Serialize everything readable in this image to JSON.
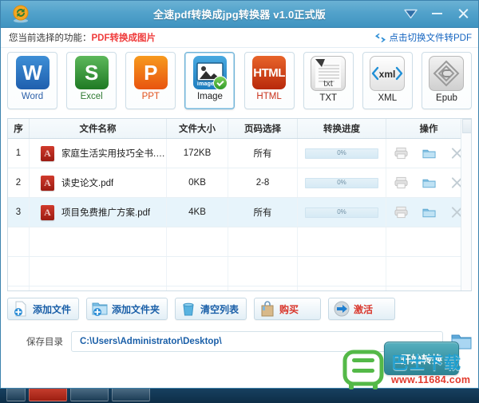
{
  "window": {
    "title": "全速pdf转换成jpg转换器 v1.0正式版",
    "logo_icon": "refresh-circle-logo",
    "controls": [
      {
        "name": "menu-dropdown",
        "icon": "chevron-down-icon"
      },
      {
        "name": "minimize",
        "icon": "minimize-icon"
      },
      {
        "name": "close",
        "icon": "close-icon"
      }
    ]
  },
  "funcbar": {
    "label": "您当前选择的功能：",
    "value": "PDF转换成图片",
    "switch_link": "点击切换文件转PDF",
    "switch_icon": "swap-arrows-icon"
  },
  "formats": [
    {
      "label": "Word",
      "icon": "word-icon",
      "glyph": "W",
      "selected": false
    },
    {
      "label": "Excel",
      "icon": "excel-icon",
      "glyph": "S",
      "selected": false
    },
    {
      "label": "PPT",
      "icon": "ppt-icon",
      "glyph": "P",
      "selected": false
    },
    {
      "label": "Image",
      "icon": "image-icon",
      "glyph": "",
      "selected": true,
      "badge": "images"
    },
    {
      "label": "HTML",
      "icon": "html-icon",
      "glyph": "HTML",
      "selected": false
    },
    {
      "label": "TXT",
      "icon": "txt-icon",
      "glyph": "txt",
      "selected": false
    },
    {
      "label": "XML",
      "icon": "xml-icon",
      "glyph": "xml",
      "selected": false
    },
    {
      "label": "Epub",
      "icon": "epub-icon",
      "glyph": "",
      "selected": false
    }
  ],
  "table": {
    "headers": {
      "index": "序",
      "filename": "文件名称",
      "filesize": "文件大小",
      "pages": "页码选择",
      "progress": "转换进度",
      "operation": "操作"
    },
    "rows": [
      {
        "index": "1",
        "filename": "家庭生活实用技巧全书.pdf",
        "filesize": "172KB",
        "pages": "所有",
        "progress": "0%",
        "progress_pct": 0,
        "selected": false
      },
      {
        "index": "2",
        "filename": "读史论文.pdf",
        "filesize": "0KB",
        "pages": "2-8",
        "progress": "0%",
        "progress_pct": 0,
        "selected": false
      },
      {
        "index": "3",
        "filename": "项目免费推广方案.pdf",
        "filesize": "4KB",
        "pages": "所有",
        "progress": "0%",
        "progress_pct": 0,
        "selected": true
      }
    ],
    "row_ops": [
      {
        "name": "preview-button",
        "icon": "printer-icon"
      },
      {
        "name": "open-folder-button",
        "icon": "folder-icon"
      },
      {
        "name": "remove-row-button",
        "icon": "close-x-icon"
      }
    ]
  },
  "actions": [
    {
      "label": "添加文件",
      "icon": "add-file-icon",
      "color": "blue"
    },
    {
      "label": "添加文件夹",
      "icon": "add-folder-icon",
      "color": "blue"
    },
    {
      "label": "清空列表",
      "icon": "trash-icon",
      "color": "blue"
    },
    {
      "label": "购买",
      "icon": "shopping-bag-icon",
      "color": "red"
    },
    {
      "label": "激活",
      "icon": "arrow-right-icon",
      "color": "red"
    }
  ],
  "save": {
    "label": "保存目录",
    "path": "C:\\Users\\Administrator\\Desktop\\",
    "browse_icon": "folder-open-icon"
  },
  "start_button": {
    "label": "开始转换"
  },
  "watermark": {
    "icon": "bus-icon",
    "title": "巴士下载",
    "url": "www.11684.com"
  },
  "colors": {
    "titlebar": "#52a2cb",
    "accent_blue": "#1a5fa8",
    "accent_red": "#ef3b3b",
    "selected_row": "#e7f4fb",
    "start_button": "#3e98a9"
  }
}
